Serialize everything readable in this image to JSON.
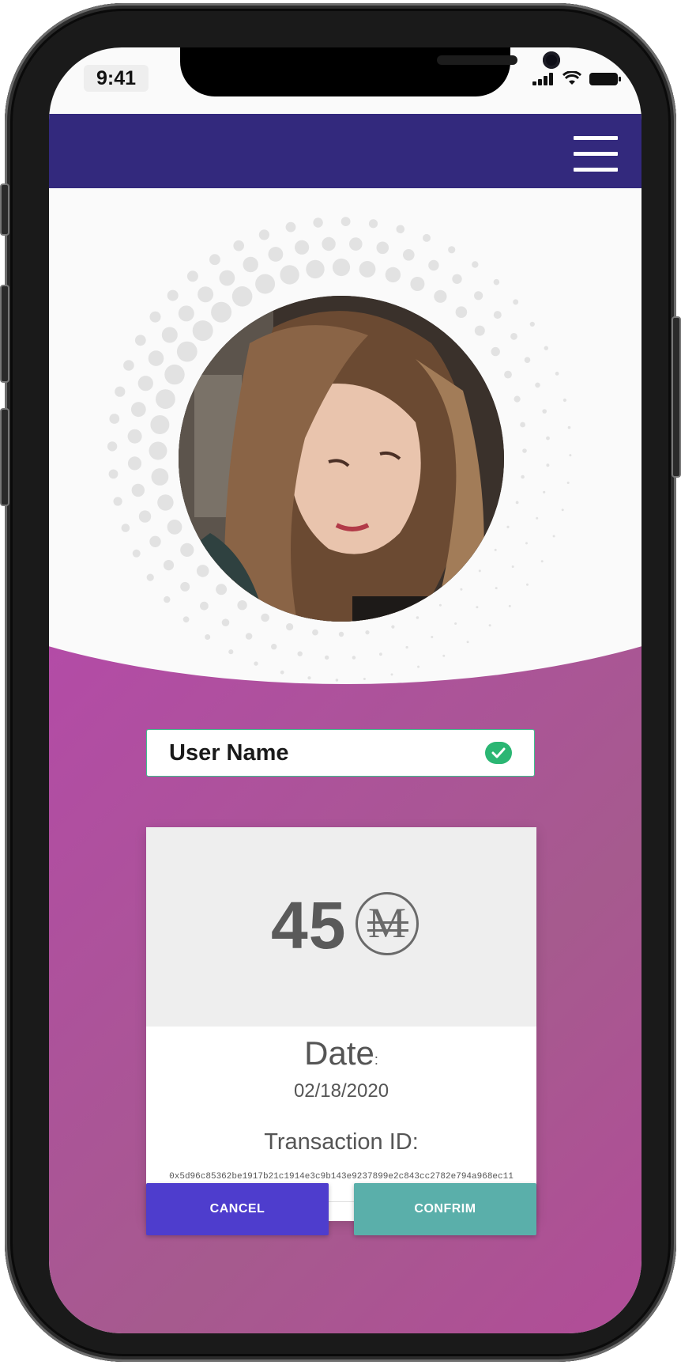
{
  "status_bar": {
    "time": "9:41"
  },
  "user": {
    "name": "User Name",
    "verified": true
  },
  "transaction": {
    "amount": "45",
    "currency_symbol": "M",
    "date_label": "Date",
    "date_colon": ":",
    "date_value": "02/18/2020",
    "id_label": "Transaction ID:",
    "id_value": "0x5d96c85362be1917b21c1914e3c9b143e9237899e2c843cc2782e794a968ec11"
  },
  "actions": {
    "cancel_label": "CANCEL",
    "confirm_label": "CONFRIM"
  },
  "colors": {
    "header": "#33297d",
    "purple": "#b44aa8",
    "cancel": "#4e3dcd",
    "confirm": "#5aafaa",
    "verified": "#2bb673"
  }
}
